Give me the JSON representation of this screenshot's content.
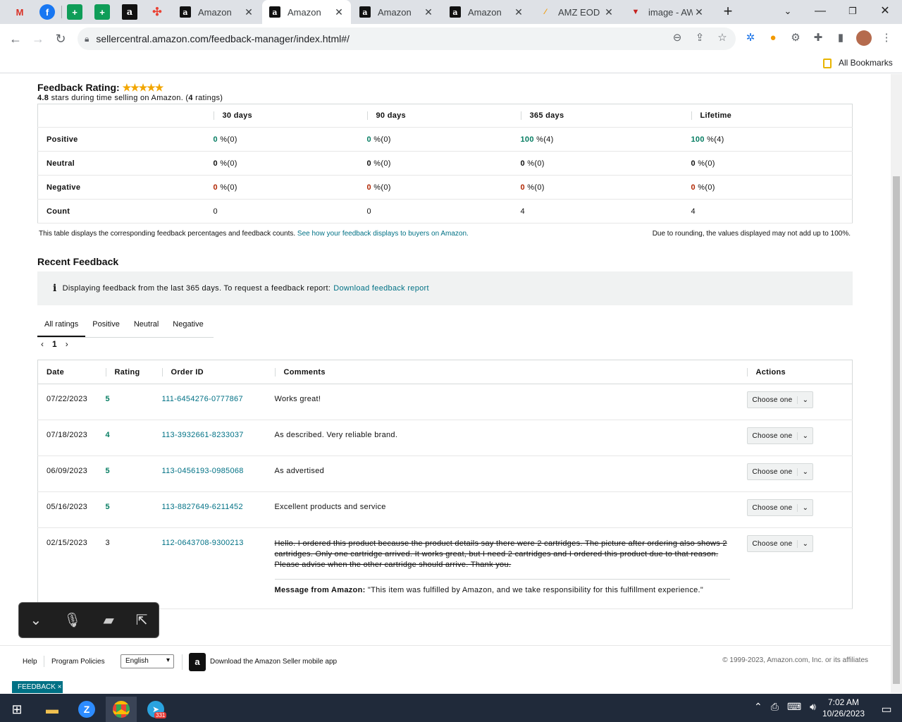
{
  "browser": {
    "tabs": [
      {
        "title": "Amazon",
        "active": false
      },
      {
        "title": "Amazon",
        "active": true
      },
      {
        "title": "Amazon",
        "active": false
      },
      {
        "title": "Amazon",
        "active": false
      },
      {
        "title": "AMZ EOD F",
        "active": false
      },
      {
        "title": "image - AW",
        "active": false
      }
    ],
    "url": "sellercentral.amazon.com/feedback-manager/index.html#/",
    "all_bookmarks": "All Bookmarks"
  },
  "rating": {
    "title": "Feedback Rating:",
    "score": "4.8",
    "sub_text": "stars during time selling on Amazon. (",
    "ratings_count": "4",
    "ratings_suffix": "ratings)"
  },
  "summary": {
    "headers": [
      "30 days",
      "90 days",
      "365 days",
      "Lifetime"
    ],
    "rows": [
      {
        "label": "Positive",
        "cells": [
          {
            "v": "0",
            "c": "(0)"
          },
          {
            "v": "0",
            "c": "(0)"
          },
          {
            "v": "100",
            "c": "(4)"
          },
          {
            "v": "100",
            "c": "(4)"
          }
        ]
      },
      {
        "label": "Neutral",
        "cells": [
          {
            "v": "0",
            "c": "(0)"
          },
          {
            "v": "0",
            "c": "(0)"
          },
          {
            "v": "0",
            "c": "(0)"
          },
          {
            "v": "0",
            "c": "(0)"
          }
        ]
      },
      {
        "label": "Negative",
        "cells": [
          {
            "v": "0",
            "c": "(0)"
          },
          {
            "v": "0",
            "c": "(0)"
          },
          {
            "v": "0",
            "c": "(0)"
          },
          {
            "v": "0",
            "c": "(0)"
          }
        ]
      }
    ],
    "pct": " %",
    "count_label": "Count",
    "counts": [
      "0",
      "0",
      "4",
      "4"
    ],
    "note_left": "This table displays the corresponding feedback percentages and feedback counts.",
    "note_link": "See how your feedback displays to buyers on Amazon.",
    "note_right": "Due to rounding, the values displayed may not add up to 100%."
  },
  "recent": {
    "title": "Recent Feedback",
    "info_text": "Displaying feedback from the last 365 days. To request a feedback report:",
    "info_link": "Download feedback report",
    "filters": [
      "All ratings",
      "Positive",
      "Neutral",
      "Negative"
    ],
    "page": "1",
    "headers": [
      "Date",
      "Rating",
      "Order ID",
      "Comments",
      "Actions"
    ],
    "choose_label": "Choose one",
    "rows": [
      {
        "date": "07/22/2023",
        "rating": "5",
        "order": "111-6454276-0777867",
        "comment": "Works great!",
        "struck": false
      },
      {
        "date": "07/18/2023",
        "rating": "4",
        "order": "113-3932661-8233037",
        "comment": "As described. Very reliable brand.",
        "struck": false
      },
      {
        "date": "06/09/2023",
        "rating": "5",
        "order": "113-0456193-0985068",
        "comment": "As advertised",
        "struck": false
      },
      {
        "date": "05/16/2023",
        "rating": "5",
        "order": "113-8827649-6211452",
        "comment": "Excellent products and service",
        "struck": false
      },
      {
        "date": "02/15/2023",
        "rating": "3",
        "order": "112-0643708-9300213",
        "comment": "Hello. I ordered this product because the product details say there were 2 cartridges. The picture after ordering also shows 2 cartridges. Only one cartridge arrived. It works great, but I need 2 cartridges and I ordered this product due to that reason. Please advise when the other cartridge should arrive. Thank you.",
        "struck": true,
        "message_label": "Message from Amazon:",
        "message": "\"This item was fulfilled by Amazon, and we take responsibility for this fulfillment experience.\""
      }
    ]
  },
  "footer": {
    "help": "Help",
    "policies": "Program Policies",
    "language": "English",
    "app_text": "Download the Amazon Seller mobile app",
    "copyright": "© 1999-2023, Amazon.com, Inc. or its affiliates",
    "feedback_btn": "FEEDBACK ×"
  },
  "taskbar": {
    "time": "7:02 AM",
    "date": "10/26/2023",
    "telegram_badge": "331"
  }
}
